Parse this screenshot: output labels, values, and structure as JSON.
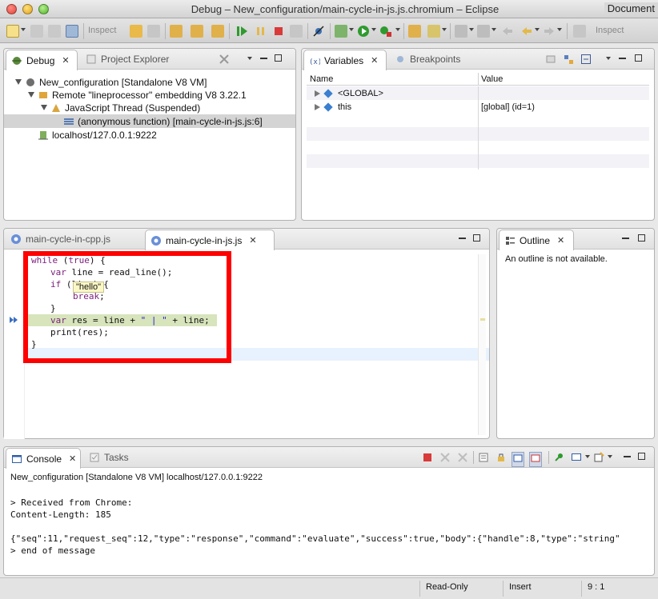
{
  "window": {
    "title": "Debug – New_configuration/main-cycle-in-js.js.chromium – Eclipse",
    "right_label": "Document"
  },
  "toolbar": {
    "inspect_label": "Inspect",
    "inspect_label_right": "Inspect"
  },
  "debug_view": {
    "tabs": [
      {
        "label": "Debug",
        "active": true
      },
      {
        "label": "Project Explorer",
        "active": false
      }
    ],
    "tree": [
      {
        "label": "New_configuration [Standalone V8 VM]",
        "icon": "launch-icon"
      },
      {
        "label": "Remote \"lineprocessor\" embedding V8 3.22.1",
        "icon": "remote-vm-icon"
      },
      {
        "label": "JavaScript Thread (Suspended)",
        "icon": "thread-icon"
      },
      {
        "label": "(anonymous function) [main-cycle-in-js.js:6]",
        "icon": "stack-frame-icon"
      },
      {
        "label": "localhost/127.0.0.1:9222",
        "icon": "process-icon"
      }
    ]
  },
  "variables_view": {
    "tabs": [
      {
        "label": "Variables",
        "active": true
      },
      {
        "label": "Breakpoints",
        "active": false
      }
    ],
    "columns": [
      "Name",
      "Value"
    ],
    "rows": [
      {
        "name": "<GLOBAL>",
        "value": ""
      },
      {
        "name": "this",
        "value": "[global]  (id=1)"
      }
    ]
  },
  "editor": {
    "tabs": [
      {
        "label": "main-cycle-in-cpp.js",
        "active": false
      },
      {
        "label": "main-cycle-in-js.js",
        "active": true
      }
    ],
    "code": {
      "l1_kw": "while",
      "l1_rest": " (",
      "l1_true": "true",
      "l1_end": ") {",
      "l2_kw": "var",
      "l2_rest": " line = read_line();",
      "l3_kw": "if",
      "l3_rest": " (line) {",
      "l4_kw": "break",
      "l4_rest": ";",
      "l5": "}",
      "l6_kw": "var",
      "l6_rest": " res = line + ",
      "l6_str": "\" | \"",
      "l6_end": " + line;",
      "l7": "print(res);",
      "l8": "}"
    },
    "hover_tooltip": "\"hello\"",
    "highlight_color": "#ff0000",
    "current_line_color": "#d7e4bc"
  },
  "outline_view": {
    "tab_label": "Outline",
    "message": "An outline is not available."
  },
  "console_view": {
    "tabs": [
      {
        "label": "Console",
        "active": true
      },
      {
        "label": "Tasks",
        "active": false
      }
    ],
    "process_label": "New_configuration [Standalone V8 VM] localhost/127.0.0.1:9222",
    "lines": [
      "> Received from Chrome:",
      "Content-Length: 185",
      "",
      "{\"seq\":11,\"request_seq\":12,\"type\":\"response\",\"command\":\"evaluate\",\"success\":true,\"body\":{\"handle\":8,\"type\":\"string\"",
      "> end of message"
    ]
  },
  "statusbar": {
    "mode": "Read-Only",
    "insert": "Insert",
    "position": "9 : 1"
  }
}
